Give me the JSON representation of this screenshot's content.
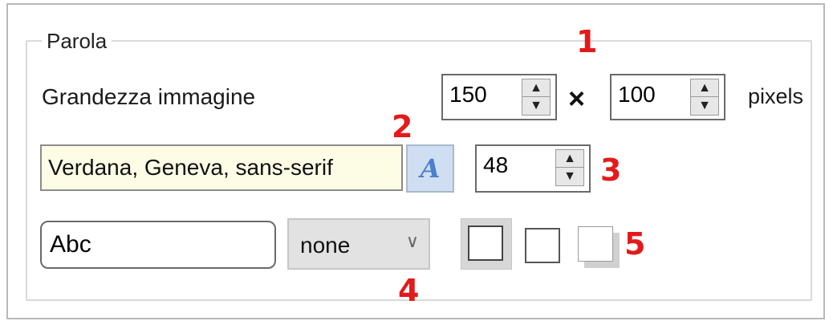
{
  "group": {
    "title": "Parola"
  },
  "image_size": {
    "label": "Grandezza immagine",
    "width": "150",
    "separator": "×",
    "height": "100",
    "unit": "pixels"
  },
  "font": {
    "family": "Verdana, Geneva, sans-serif",
    "button_glyph": "A",
    "size": "48"
  },
  "preview": {
    "text": "Abc"
  },
  "decoration": {
    "selected": "none"
  },
  "spinner": {
    "up": "▲",
    "down": "▼"
  },
  "icons": {
    "dropdown_chevron": "∨"
  },
  "annotations": {
    "a1": "1",
    "a2": "2",
    "a3": "3",
    "a4": "4",
    "a5": "5"
  },
  "colors": {
    "annotation": "#e41a1a",
    "font_field_bg": "#fdfde6",
    "font_button_bg": "#cfdef0"
  }
}
